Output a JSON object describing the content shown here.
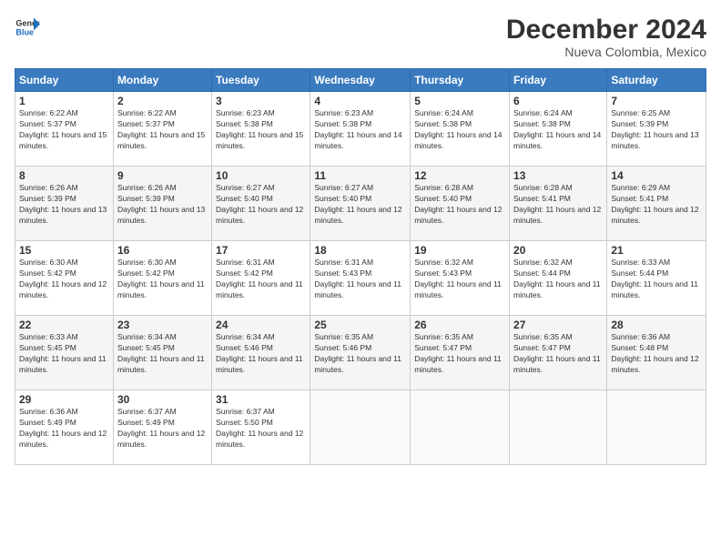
{
  "header": {
    "logo_line1": "General",
    "logo_line2": "Blue",
    "month": "December 2024",
    "location": "Nueva Colombia, Mexico"
  },
  "weekdays": [
    "Sunday",
    "Monday",
    "Tuesday",
    "Wednesday",
    "Thursday",
    "Friday",
    "Saturday"
  ],
  "weeks": [
    [
      {
        "day": "1",
        "sunrise": "6:22 AM",
        "sunset": "5:37 PM",
        "daylight": "11 hours and 15 minutes."
      },
      {
        "day": "2",
        "sunrise": "6:22 AM",
        "sunset": "5:37 PM",
        "daylight": "11 hours and 15 minutes."
      },
      {
        "day": "3",
        "sunrise": "6:23 AM",
        "sunset": "5:38 PM",
        "daylight": "11 hours and 15 minutes."
      },
      {
        "day": "4",
        "sunrise": "6:23 AM",
        "sunset": "5:38 PM",
        "daylight": "11 hours and 14 minutes."
      },
      {
        "day": "5",
        "sunrise": "6:24 AM",
        "sunset": "5:38 PM",
        "daylight": "11 hours and 14 minutes."
      },
      {
        "day": "6",
        "sunrise": "6:24 AM",
        "sunset": "5:38 PM",
        "daylight": "11 hours and 14 minutes."
      },
      {
        "day": "7",
        "sunrise": "6:25 AM",
        "sunset": "5:39 PM",
        "daylight": "11 hours and 13 minutes."
      }
    ],
    [
      {
        "day": "8",
        "sunrise": "6:26 AM",
        "sunset": "5:39 PM",
        "daylight": "11 hours and 13 minutes."
      },
      {
        "day": "9",
        "sunrise": "6:26 AM",
        "sunset": "5:39 PM",
        "daylight": "11 hours and 13 minutes."
      },
      {
        "day": "10",
        "sunrise": "6:27 AM",
        "sunset": "5:40 PM",
        "daylight": "11 hours and 12 minutes."
      },
      {
        "day": "11",
        "sunrise": "6:27 AM",
        "sunset": "5:40 PM",
        "daylight": "11 hours and 12 minutes."
      },
      {
        "day": "12",
        "sunrise": "6:28 AM",
        "sunset": "5:40 PM",
        "daylight": "11 hours and 12 minutes."
      },
      {
        "day": "13",
        "sunrise": "6:28 AM",
        "sunset": "5:41 PM",
        "daylight": "11 hours and 12 minutes."
      },
      {
        "day": "14",
        "sunrise": "6:29 AM",
        "sunset": "5:41 PM",
        "daylight": "11 hours and 12 minutes."
      }
    ],
    [
      {
        "day": "15",
        "sunrise": "6:30 AM",
        "sunset": "5:42 PM",
        "daylight": "11 hours and 12 minutes."
      },
      {
        "day": "16",
        "sunrise": "6:30 AM",
        "sunset": "5:42 PM",
        "daylight": "11 hours and 11 minutes."
      },
      {
        "day": "17",
        "sunrise": "6:31 AM",
        "sunset": "5:42 PM",
        "daylight": "11 hours and 11 minutes."
      },
      {
        "day": "18",
        "sunrise": "6:31 AM",
        "sunset": "5:43 PM",
        "daylight": "11 hours and 11 minutes."
      },
      {
        "day": "19",
        "sunrise": "6:32 AM",
        "sunset": "5:43 PM",
        "daylight": "11 hours and 11 minutes."
      },
      {
        "day": "20",
        "sunrise": "6:32 AM",
        "sunset": "5:44 PM",
        "daylight": "11 hours and 11 minutes."
      },
      {
        "day": "21",
        "sunrise": "6:33 AM",
        "sunset": "5:44 PM",
        "daylight": "11 hours and 11 minutes."
      }
    ],
    [
      {
        "day": "22",
        "sunrise": "6:33 AM",
        "sunset": "5:45 PM",
        "daylight": "11 hours and 11 minutes."
      },
      {
        "day": "23",
        "sunrise": "6:34 AM",
        "sunset": "5:45 PM",
        "daylight": "11 hours and 11 minutes."
      },
      {
        "day": "24",
        "sunrise": "6:34 AM",
        "sunset": "5:46 PM",
        "daylight": "11 hours and 11 minutes."
      },
      {
        "day": "25",
        "sunrise": "6:35 AM",
        "sunset": "5:46 PM",
        "daylight": "11 hours and 11 minutes."
      },
      {
        "day": "26",
        "sunrise": "6:35 AM",
        "sunset": "5:47 PM",
        "daylight": "11 hours and 11 minutes."
      },
      {
        "day": "27",
        "sunrise": "6:35 AM",
        "sunset": "5:47 PM",
        "daylight": "11 hours and 11 minutes."
      },
      {
        "day": "28",
        "sunrise": "6:36 AM",
        "sunset": "5:48 PM",
        "daylight": "11 hours and 12 minutes."
      }
    ],
    [
      {
        "day": "29",
        "sunrise": "6:36 AM",
        "sunset": "5:49 PM",
        "daylight": "11 hours and 12 minutes."
      },
      {
        "day": "30",
        "sunrise": "6:37 AM",
        "sunset": "5:49 PM",
        "daylight": "11 hours and 12 minutes."
      },
      {
        "day": "31",
        "sunrise": "6:37 AM",
        "sunset": "5:50 PM",
        "daylight": "11 hours and 12 minutes."
      },
      null,
      null,
      null,
      null
    ]
  ]
}
